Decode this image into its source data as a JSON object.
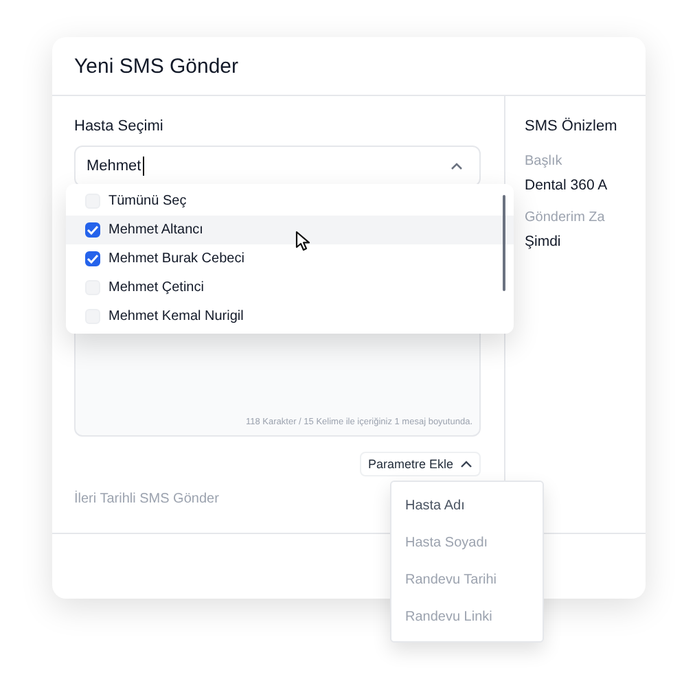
{
  "dialog": {
    "title": "Yeni SMS Gönder"
  },
  "patient_select": {
    "label": "Hasta Seçimi",
    "value": "Mehmet",
    "expanded": true,
    "options": [
      {
        "label": "Tümünü Seç",
        "checked": false,
        "highlighted": false
      },
      {
        "label": "Mehmet Altancı",
        "checked": true,
        "highlighted": true
      },
      {
        "label": "Mehmet Burak Cebeci",
        "checked": true,
        "highlighted": false
      },
      {
        "label": "Mehmet Çetinci",
        "checked": false,
        "highlighted": false
      },
      {
        "label": "Mehmet Kemal Nurigil",
        "checked": false,
        "highlighted": false
      }
    ]
  },
  "message": {
    "counter": "118 Karakter / 15 Kelime ile içeriğiniz 1 mesaj boyutunda."
  },
  "parameter_menu": {
    "button": "Parametre Ekle",
    "expanded": true,
    "items": [
      {
        "label": "Hasta Adı",
        "selected": true
      },
      {
        "label": "Hasta Soyadı",
        "selected": false
      },
      {
        "label": "Randevu Tarihi",
        "selected": false
      },
      {
        "label": "Randevu Linki",
        "selected": false
      }
    ]
  },
  "schedule_toggle": {
    "label": "İleri Tarihli SMS Gönder"
  },
  "preview": {
    "title": "SMS Önizlem",
    "fields": [
      {
        "label": "Başlık",
        "value": "Dental 360 A"
      },
      {
        "label": "Gönderim Za",
        "value": "Şimdi"
      }
    ]
  }
}
